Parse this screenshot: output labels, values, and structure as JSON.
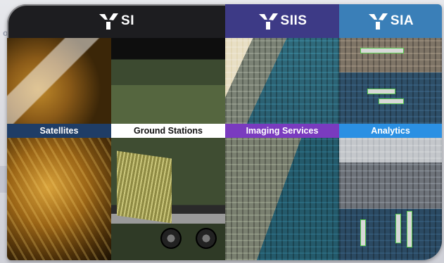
{
  "colors": {
    "purple_header": "#3d3a86",
    "blue_header": "#3a7fb8",
    "satellites_bar": "#1f3d66",
    "imaging_bar": "#7a3bbf",
    "analytics_bar": "#2b90e3"
  },
  "columns": [
    {
      "logo_text": "SI",
      "label": "Satellites"
    },
    {
      "logo_text": "",
      "label": "Ground Stations"
    },
    {
      "logo_text": "SIIS",
      "label": "Imaging Services"
    },
    {
      "logo_text": "SIA",
      "label": "Analytics"
    }
  ]
}
